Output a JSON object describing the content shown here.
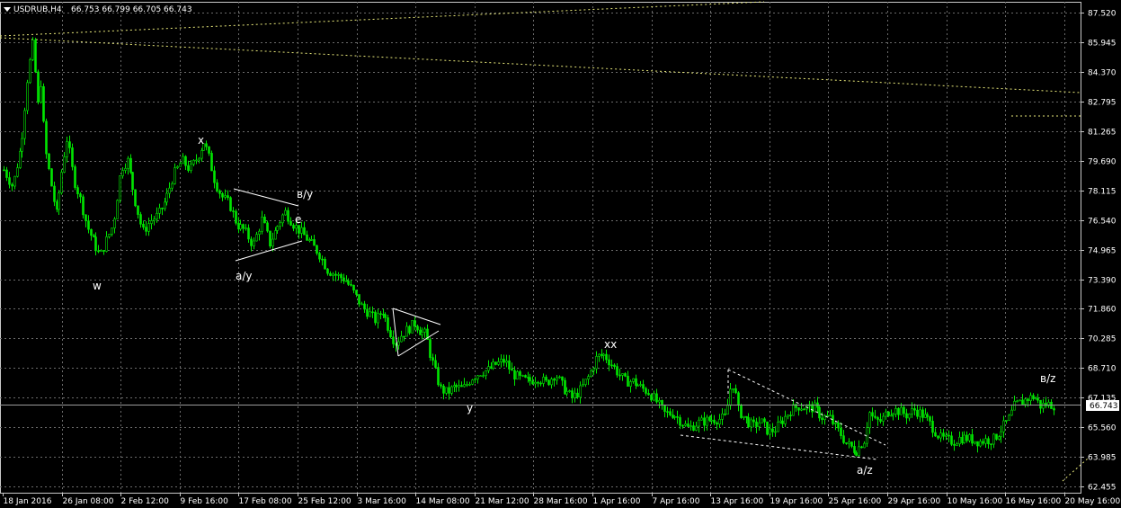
{
  "header": {
    "symbol_timeframe": "USDRUB,H4",
    "ohlc": "66.753 66.799 66.705 66.743"
  },
  "chart_data": {
    "type": "candlestick",
    "symbol": "USDRUB",
    "timeframe": "H4",
    "price_axis_ticks": [
      "87.520",
      "85.945",
      "84.370",
      "82.795",
      "81.265",
      "79.690",
      "78.115",
      "76.540",
      "74.965",
      "73.390",
      "71.860",
      "70.285",
      "68.710",
      "67.135",
      "65.560",
      "63.985",
      "62.455"
    ],
    "time_axis_ticks": [
      "18 Jan 2016",
      "26 Jan 08:00",
      "2 Feb 12:00",
      "9 Feb 16:00",
      "17 Feb 08:00",
      "25 Feb 12:00",
      "3 Mar 16:00",
      "14 Mar 08:00",
      "21 Mar 12:00",
      "28 Mar 16:00",
      "1 Apr 16:00",
      "7 Apr 16:00",
      "13 Apr 16:00",
      "19 Apr 16:00",
      "25 Apr 16:00",
      "29 Apr 16:00",
      "10 May 16:00",
      "16 May 16:00",
      "20 May 16:00"
    ],
    "current_price": "66.743",
    "ylim": [
      62.1,
      88.1
    ],
    "price_path": [
      [
        0.0,
        79.2
      ],
      [
        0.008,
        78.3
      ],
      [
        0.016,
        80.6
      ],
      [
        0.022,
        84.2
      ],
      [
        0.027,
        86.0
      ],
      [
        0.031,
        82.5
      ],
      [
        0.034,
        84.0
      ],
      [
        0.037,
        80.5
      ],
      [
        0.042,
        78.8
      ],
      [
        0.048,
        76.8
      ],
      [
        0.054,
        79.6
      ],
      [
        0.058,
        80.9
      ],
      [
        0.064,
        78.7
      ],
      [
        0.07,
        77.6
      ],
      [
        0.076,
        76.2
      ],
      [
        0.082,
        75.4
      ],
      [
        0.088,
        74.6
      ],
      [
        0.094,
        75.5
      ],
      [
        0.1,
        76.3
      ],
      [
        0.107,
        79.3
      ],
      [
        0.113,
        79.7
      ],
      [
        0.12,
        77.6
      ],
      [
        0.127,
        75.9
      ],
      [
        0.134,
        76.5
      ],
      [
        0.141,
        76.8
      ],
      [
        0.148,
        77.6
      ],
      [
        0.155,
        78.9
      ],
      [
        0.163,
        79.7
      ],
      [
        0.17,
        79.2
      ],
      [
        0.177,
        79.9
      ],
      [
        0.183,
        80.7
      ],
      [
        0.188,
        79.8
      ],
      [
        0.193,
        78.6
      ],
      [
        0.199,
        77.8
      ],
      [
        0.206,
        77.4
      ],
      [
        0.213,
        76.3
      ],
      [
        0.22,
        76.0
      ],
      [
        0.228,
        75.2
      ],
      [
        0.236,
        76.6
      ],
      [
        0.243,
        75.3
      ],
      [
        0.25,
        76.2
      ],
      [
        0.257,
        77.0
      ],
      [
        0.265,
        76.3
      ],
      [
        0.273,
        75.8
      ],
      [
        0.281,
        75.3
      ],
      [
        0.288,
        74.8
      ],
      [
        0.296,
        73.9
      ],
      [
        0.304,
        73.6
      ],
      [
        0.312,
        73.4
      ],
      [
        0.318,
        72.9
      ],
      [
        0.323,
        72.4
      ],
      [
        0.328,
        71.9
      ],
      [
        0.334,
        71.6
      ],
      [
        0.34,
        71.2
      ],
      [
        0.346,
        71.8
      ],
      [
        0.352,
        70.8
      ],
      [
        0.358,
        70.0
      ],
      [
        0.364,
        70.5
      ],
      [
        0.37,
        70.8
      ],
      [
        0.376,
        71.1
      ],
      [
        0.381,
        70.6
      ],
      [
        0.386,
        70.5
      ],
      [
        0.39,
        69.4
      ],
      [
        0.394,
        68.6
      ],
      [
        0.399,
        67.6
      ],
      [
        0.405,
        67.4
      ],
      [
        0.412,
        67.7
      ],
      [
        0.42,
        67.6
      ],
      [
        0.428,
        68.2
      ],
      [
        0.436,
        68.5
      ],
      [
        0.443,
        68.6
      ],
      [
        0.45,
        68.9
      ],
      [
        0.458,
        69.1
      ],
      [
        0.465,
        68.4
      ],
      [
        0.473,
        68.1
      ],
      [
        0.48,
        68.0
      ],
      [
        0.488,
        68.2
      ],
      [
        0.496,
        67.9
      ],
      [
        0.504,
        68.4
      ],
      [
        0.512,
        67.6
      ],
      [
        0.52,
        67.1
      ],
      [
        0.528,
        67.6
      ],
      [
        0.535,
        68.3
      ],
      [
        0.542,
        69.3
      ],
      [
        0.549,
        69.4
      ],
      [
        0.556,
        68.9
      ],
      [
        0.562,
        68.4
      ],
      [
        0.568,
        68.0
      ],
      [
        0.575,
        68.0
      ],
      [
        0.582,
        67.7
      ],
      [
        0.59,
        67.4
      ],
      [
        0.597,
        66.9
      ],
      [
        0.604,
        66.3
      ],
      [
        0.612,
        66.3
      ],
      [
        0.619,
        65.9
      ],
      [
        0.626,
        65.5
      ],
      [
        0.634,
        65.8
      ],
      [
        0.641,
        65.9
      ],
      [
        0.648,
        66.0
      ],
      [
        0.655,
        66.0
      ],
      [
        0.66,
        66.1
      ],
      [
        0.664,
        67.6
      ],
      [
        0.667,
        67.9
      ],
      [
        0.671,
        66.5
      ],
      [
        0.678,
        66.0
      ],
      [
        0.685,
        65.6
      ],
      [
        0.692,
        65.9
      ],
      [
        0.699,
        65.3
      ],
      [
        0.706,
        65.5
      ],
      [
        0.713,
        66.0
      ],
      [
        0.72,
        66.5
      ],
      [
        0.727,
        66.7
      ],
      [
        0.734,
        66.6
      ],
      [
        0.741,
        66.6
      ],
      [
        0.748,
        66.1
      ],
      [
        0.755,
        66.1
      ],
      [
        0.76,
        65.6
      ],
      [
        0.765,
        65.2
      ],
      [
        0.77,
        64.7
      ],
      [
        0.775,
        64.5
      ],
      [
        0.779,
        64.3
      ],
      [
        0.783,
        64.6
      ],
      [
        0.787,
        64.9
      ],
      [
        0.791,
        66.4
      ],
      [
        0.796,
        65.9
      ],
      [
        0.802,
        65.9
      ],
      [
        0.808,
        66.4
      ],
      [
        0.814,
        66.5
      ],
      [
        0.82,
        66.4
      ],
      [
        0.826,
        66.2
      ],
      [
        0.832,
        66.5
      ],
      [
        0.838,
        66.3
      ],
      [
        0.844,
        66.0
      ],
      [
        0.85,
        65.5
      ],
      [
        0.856,
        65.0
      ],
      [
        0.862,
        64.9
      ],
      [
        0.868,
        64.8
      ],
      [
        0.874,
        65.0
      ],
      [
        0.88,
        65.0
      ],
      [
        0.886,
        64.9
      ],
      [
        0.892,
        64.8
      ],
      [
        0.898,
        64.9
      ],
      [
        0.904,
        64.9
      ],
      [
        0.91,
        65.3
      ],
      [
        0.915,
        65.7
      ],
      [
        0.92,
        66.1
      ],
      [
        0.924,
        66.7
      ],
      [
        0.93,
        66.9
      ],
      [
        0.936,
        67.1
      ],
      [
        0.942,
        67.2
      ],
      [
        0.948,
        66.7
      ],
      [
        0.954,
        66.8
      ],
      [
        0.96,
        66.74
      ]
    ],
    "wave_labels": [
      "w",
      "x",
      "a/y",
      "в/y",
      "e",
      "y",
      "xx",
      "a/z",
      "в/z"
    ]
  }
}
